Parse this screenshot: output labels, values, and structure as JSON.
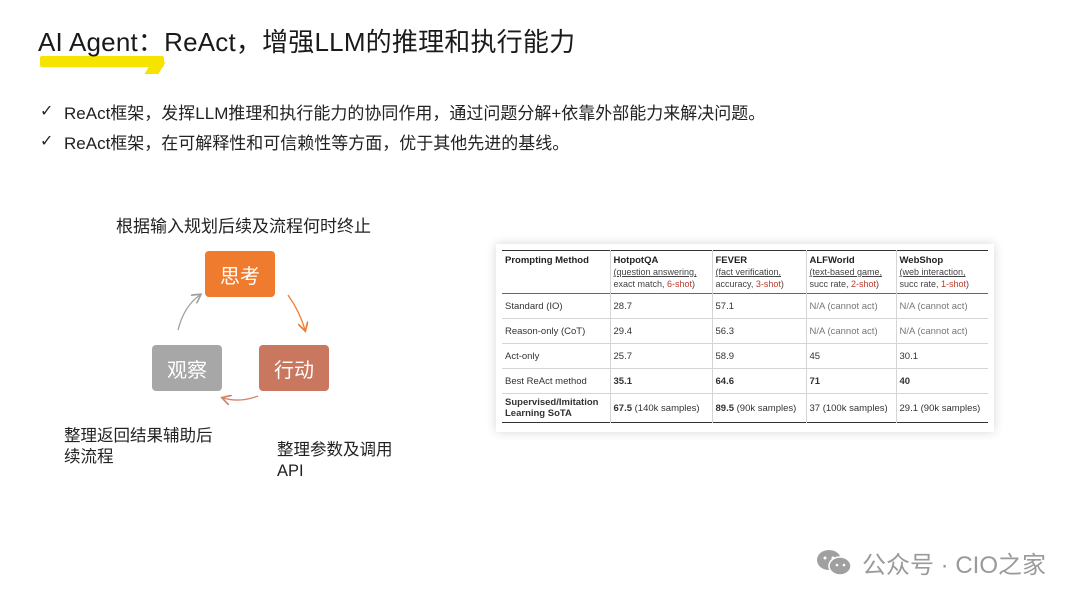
{
  "title": "AI Agent：ReAct，增强LLM的推理和执行能力",
  "bullets": [
    {
      "icon": "check-icon",
      "text": "ReAct框架，发挥LLM推理和执行能力的协同作用，通过问题分解+依靠外部能力来解决问题。"
    },
    {
      "icon": "check-icon",
      "text": "ReAct框架，在可解释性和可信赖性等方面，优于其他先进的基线。"
    }
  ],
  "cycle": {
    "caption": "根据输入规划后续及流程何时终止",
    "think": "思考",
    "act": "行动",
    "observe": "观察",
    "observe_note": "整理返回结果辅助后续流程",
    "act_note": "整理参数及调用API",
    "colors": {
      "think": "#ef7b2f",
      "act": "#c9785f",
      "observe": "#a7a7a7"
    }
  },
  "table": {
    "headers": [
      {
        "name": "Prompting Method",
        "sub1": "",
        "sub2": "",
        "shot": ""
      },
      {
        "name": "HotpotQA",
        "sub1": "(question answering,",
        "sub2": "exact match, ",
        "shot": "6-shot"
      },
      {
        "name": "FEVER",
        "sub1": "(fact verification,",
        "sub2": "accuracy, ",
        "shot": "3-shot"
      },
      {
        "name": "ALFWorld",
        "sub1": "(text-based game,",
        "sub2": "succ rate, ",
        "shot": "2-shot"
      },
      {
        "name": "WebShop",
        "sub1": "(web interaction,",
        "sub2": "succ rate, ",
        "shot": "1-shot"
      }
    ],
    "rows": [
      {
        "method": "Standard (IO)",
        "hotpotqa": "28.7",
        "fever": "57.1",
        "alfworld": "N/A (cannot act)",
        "webshop": "N/A (cannot act)"
      },
      {
        "method": "Reason-only (CoT)",
        "hotpotqa": "29.4",
        "fever": "56.3",
        "alfworld": "N/A (cannot act)",
        "webshop": "N/A (cannot act)"
      },
      {
        "method": "Act-only",
        "hotpotqa": "25.7",
        "fever": "58.9",
        "alfworld": "45",
        "webshop": "30.1"
      },
      {
        "method": "Best ReAct method",
        "hotpotqa": "35.1",
        "fever": "64.6",
        "alfworld": "71",
        "webshop": "40"
      }
    ],
    "sota": {
      "method": "Supervised/Imitation Learning SoTA",
      "hotpotqa_val": "67.5",
      "hotpotqa_note": " (140k samples)",
      "fever_val": "89.5",
      "fever_note": " (90k samples)",
      "alfworld": "37 (100k samples)",
      "webshop": "29.1 (90k samples)"
    }
  },
  "watermark": {
    "icon": "wechat-icon",
    "text": "公众号 · CIO之家"
  }
}
